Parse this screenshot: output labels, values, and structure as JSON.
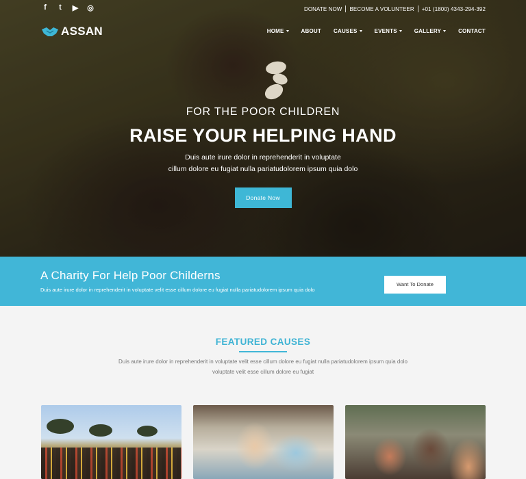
{
  "topbar": {
    "social_icons": [
      "facebook-icon",
      "twitter-icon",
      "youtube-icon",
      "instagram-icon"
    ],
    "social_glyphs": [
      "f",
      "t",
      "▶",
      "◎"
    ],
    "links": [
      "DONATE NOW",
      "BECOME A VOLUNTEER",
      "+01 (1800) 4343-294-392"
    ]
  },
  "nav": {
    "logo_text": "ASSAN",
    "menu": [
      {
        "label": "HOME",
        "dropdown": true
      },
      {
        "label": "ABOUT",
        "dropdown": false
      },
      {
        "label": "CAUSES",
        "dropdown": true
      },
      {
        "label": "EVENTS",
        "dropdown": true
      },
      {
        "label": "GALLERY",
        "dropdown": true
      },
      {
        "label": "CONTACT",
        "dropdown": false
      }
    ]
  },
  "hero": {
    "subtitle": "FOR THE POOR CHILDREN",
    "title": "RAISE YOUR HELPING HAND",
    "text_line1": "Duis aute irure dolor in reprehenderit in voluptate",
    "text_line2": "cillum dolore eu fugiat nulla pariatudolorem ipsum quia dolo",
    "button": "Donate Now"
  },
  "cta": {
    "title": "A Charity For Help Poor Childerns",
    "text": "Duis aute irure dolor in reprehenderit in voluptate velit esse cillum dolore eu fugiat nulla pariatudolorem ipsum quia dolo",
    "button": "Want To Donate"
  },
  "featured": {
    "title": "FEATURED CAUSES",
    "text_line1": "Duis aute irure dolor in reprehenderit in voluptate velit esse cillum dolore eu fugiat nulla pariatudolorem ipsum quia dolo",
    "text_line2": "voluptate velit esse cillum dolore eu fugiat"
  },
  "colors": {
    "accent": "#41b6d7",
    "heading_accent": "#3eb3d4"
  }
}
